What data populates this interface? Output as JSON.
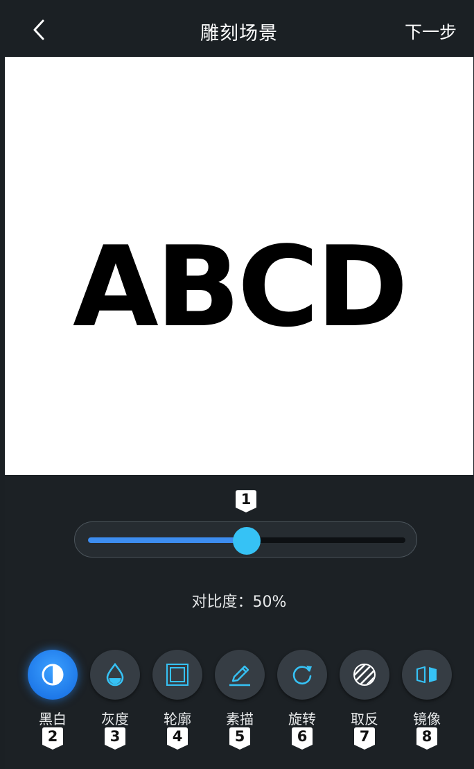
{
  "header": {
    "title": "雕刻场景",
    "next_label": "下一步",
    "back_icon": "chevron-left-icon"
  },
  "canvas": {
    "preview_text": "ABCD"
  },
  "slider": {
    "marker": "1",
    "value_percent": 50,
    "accent_color": "#3d8df0",
    "thumb_color": "#36c2f5"
  },
  "contrast_label": "对比度：50%",
  "tools": [
    {
      "label": "黑白",
      "marker": "2",
      "icon": "contrast-half-icon",
      "active": true
    },
    {
      "label": "灰度",
      "marker": "3",
      "icon": "water-drop-icon",
      "active": false
    },
    {
      "label": "轮廓",
      "marker": "4",
      "icon": "outline-frame-icon",
      "active": false
    },
    {
      "label": "素描",
      "marker": "5",
      "icon": "pencil-icon",
      "active": false
    },
    {
      "label": "旋转",
      "marker": "6",
      "icon": "rotate-icon",
      "active": false
    },
    {
      "label": "取反",
      "marker": "7",
      "icon": "invert-stripes-icon",
      "active": false
    },
    {
      "label": "镜像",
      "marker": "8",
      "icon": "mirror-icon",
      "active": false
    }
  ]
}
